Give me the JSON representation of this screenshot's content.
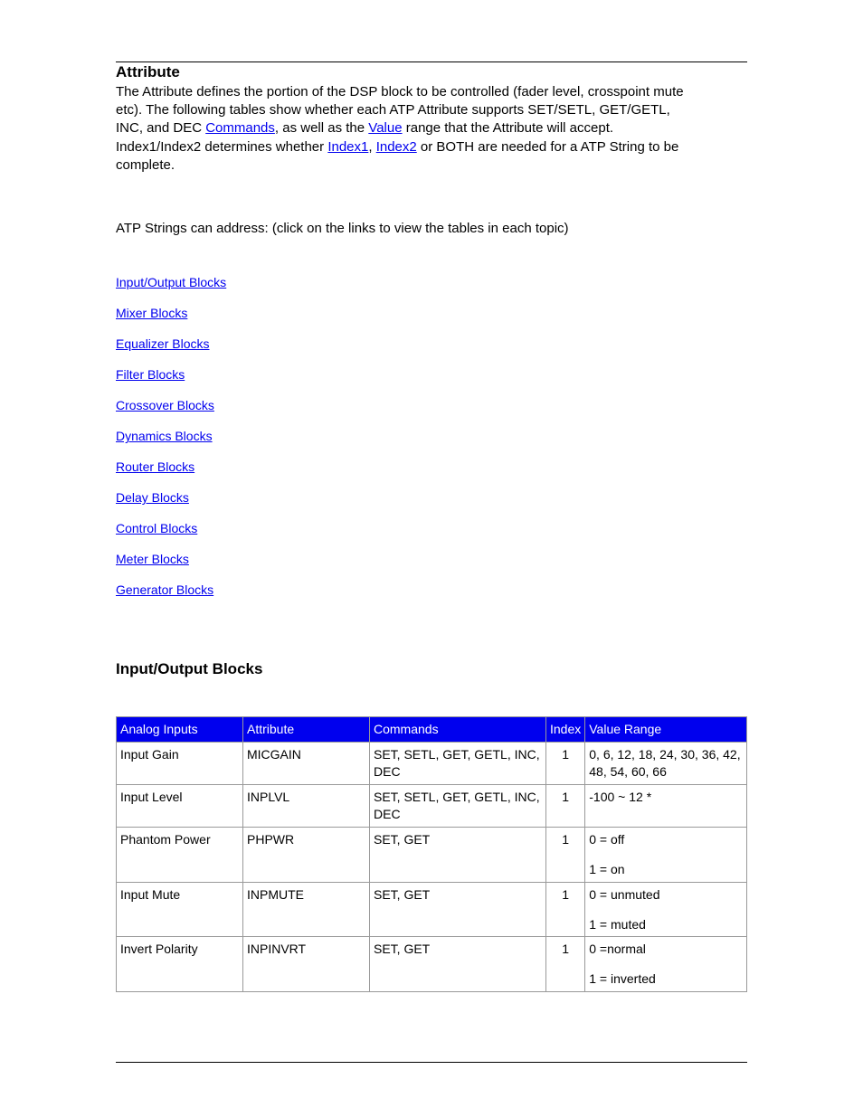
{
  "heading_title": "Attribute",
  "intro": {
    "l1a": "The Attribute defines the portion of the DSP block to be controlled (fader level, crosspoint mute",
    "l2a": "etc). The following tables show whether each ATP Attribute supports SET/SETL, GET/GETL,",
    "l3a": "INC, and DEC ",
    "l3b": ", as well as the ",
    "l3c": " range that the Attribute will accept.",
    "l4a": "Index1/Index2 determines whether ",
    "l4b": ", ",
    "l4c": " or BOTH are needed for a ATP String to be",
    "l5a": "complete."
  },
  "ph": {
    "commands": "Commands",
    "value": "Value",
    "index1": "Index1",
    "index2": "Index2"
  },
  "address_line": "ATP Strings can address: (click on the links to view the tables in each topic)",
  "link_list": [
    "Input/Output Blocks",
    "Mixer Blocks",
    "Equalizer Blocks",
    "Filter Blocks",
    "Crossover Blocks",
    "Dynamics Blocks",
    "Router Blocks",
    "Delay Blocks",
    "Control Blocks",
    "Meter Blocks",
    "Generator Blocks"
  ],
  "io_heading": "Input/Output Blocks",
  "table": {
    "headers": [
      "Analog Inputs",
      "Attribute",
      "Commands",
      "Index",
      "Value Range"
    ],
    "rows": [
      {
        "a": "Input Gain",
        "b": "MICGAIN",
        "c": "SET, SETL, GET, GETL, INC, DEC",
        "d": "1",
        "e1": "0, 6, 12, 18, 24, 30, 36, 42, 48, 54, 60, 66",
        "e2": ""
      },
      {
        "a": "Input Level",
        "b": "INPLVL",
        "c": "SET, SETL, GET, GETL, INC, DEC",
        "d": "1",
        "e1": "-100 ~ 12 *",
        "e2": ""
      },
      {
        "a": "Phantom Power",
        "b": "PHPWR",
        "c": "SET, GET",
        "d": "1",
        "e1": "0 = off",
        "e2": "1 = on"
      },
      {
        "a": "Input Mute",
        "b": "INPMUTE",
        "c": "SET, GET",
        "d": "1",
        "e1": "0 = unmuted",
        "e2": "1 = muted"
      },
      {
        "a": "Invert Polarity",
        "b": "INPINVRT",
        "c": "SET, GET",
        "d": "1",
        "e1": "0 =normal",
        "e2": "1 = inverted"
      }
    ]
  }
}
